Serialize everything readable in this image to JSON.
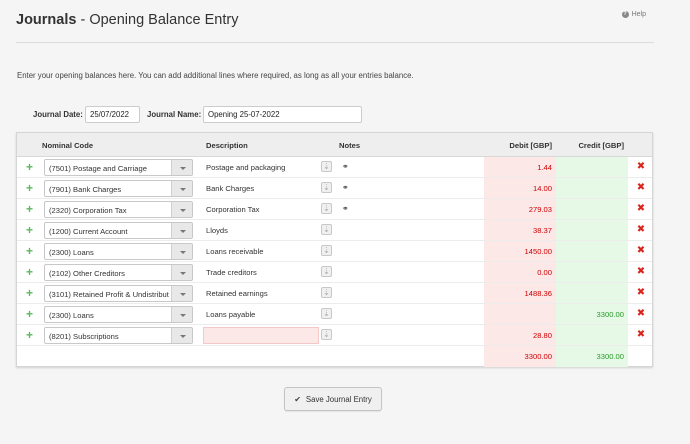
{
  "header": {
    "title_bold": "Journals",
    "title_rest": " - Opening Balance Entry",
    "help_label": "Help"
  },
  "intro": "Enter your opening balances here. You can add additional lines where required, as long as all your entries balance.",
  "journal_date": {
    "label": "Journal Date:",
    "value": "25/07/2022"
  },
  "journal_name": {
    "label": "Journal Name:",
    "value": "Opening 25-07-2022"
  },
  "columns": {
    "nominal": "Nominal Code",
    "description": "Description",
    "notes": "Notes",
    "debit": "Debit [GBP]",
    "credit": "Credit [GBP]"
  },
  "rows": [
    {
      "nominal": "(7501) Postage and Carriage",
      "description": "Postage and packaging",
      "notes": "⚭",
      "debit": "1.44",
      "credit": ""
    },
    {
      "nominal": "(7901) Bank Charges",
      "description": "Bank Charges",
      "notes": "⚭",
      "debit": "14.00",
      "credit": ""
    },
    {
      "nominal": "(2320) Corporation Tax",
      "description": "Corporation Tax",
      "notes": "⚭",
      "debit": "279.03",
      "credit": ""
    },
    {
      "nominal": "(1200) Current Account",
      "description": "Lloyds",
      "notes": "",
      "debit": "38.37",
      "credit": ""
    },
    {
      "nominal": "(2300) Loans",
      "description": "Loans receivable",
      "notes": "",
      "debit": "1450.00",
      "credit": ""
    },
    {
      "nominal": "(2102) Other Creditors",
      "description": "Trade creditors",
      "notes": "",
      "debit": "0.00",
      "credit": ""
    },
    {
      "nominal": "(3101) Retained Profit & Undistribut",
      "description": "Retained earnings",
      "notes": "",
      "debit": "1488.36",
      "credit": ""
    },
    {
      "nominal": "(2300) Loans",
      "description": "Loans payable",
      "notes": "",
      "debit": "",
      "credit": "3300.00"
    },
    {
      "nominal": "(8201) Subscriptions",
      "description": "",
      "notes": "",
      "debit": "28.80",
      "credit": ""
    }
  ],
  "totals": {
    "debit": "3300.00",
    "credit": "3300.00"
  },
  "save_label": "Save Journal Entry",
  "icons": {
    "add_row": "plus-icon",
    "delete_row": "close-icon",
    "select_arrow": "chevron-down-icon",
    "description_lookup": "download-icon",
    "note": "link-icon",
    "save": "check-icon",
    "help": "question-circle-icon"
  },
  "colors": {
    "debit_text": "#cc0000",
    "credit_text": "#2a9a2a",
    "debit_bg": "#fde8e8",
    "credit_bg": "#e6f9e6",
    "add_icon": "#5cb85c",
    "delete_icon": "#d9261c"
  }
}
